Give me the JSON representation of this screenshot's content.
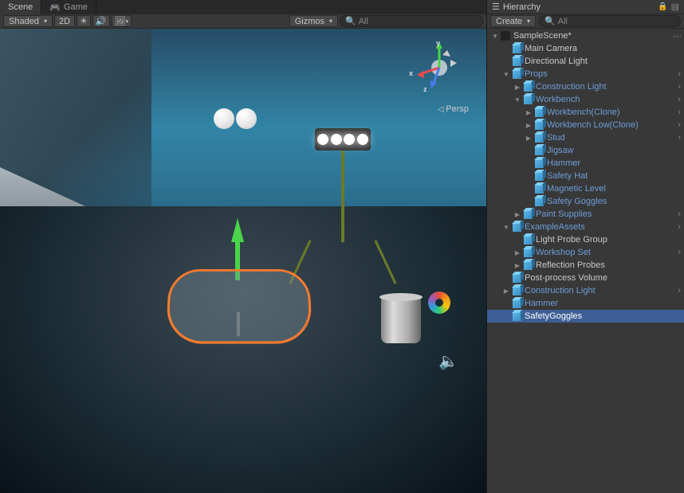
{
  "tabs": {
    "scene": "Scene",
    "game": "Game"
  },
  "scene_toolbar": {
    "shading": "Shaded",
    "mode_2d": "2D",
    "gizmos": "Gizmos",
    "search_placeholder": "All"
  },
  "gizmo": {
    "x": "x",
    "y": "y",
    "z": "z",
    "persp": "Persp"
  },
  "hierarchy": {
    "title": "Hierarchy",
    "create": "Create",
    "search_placeholder": "All",
    "tree": [
      {
        "label": "SampleScene*",
        "depth": 0,
        "expanded": true,
        "icon": "unity",
        "prefab": false,
        "chev": false,
        "menu": true
      },
      {
        "label": "Main Camera",
        "depth": 1,
        "expanded": null,
        "icon": "cube",
        "prefab": false,
        "chev": false
      },
      {
        "label": "Directional Light",
        "depth": 1,
        "expanded": null,
        "icon": "cube",
        "prefab": false,
        "chev": false
      },
      {
        "label": "Props",
        "depth": 1,
        "expanded": true,
        "icon": "cube",
        "prefab": true,
        "chev": true
      },
      {
        "label": "Construction Light",
        "depth": 2,
        "expanded": false,
        "icon": "cube",
        "prefab": true,
        "chev": true
      },
      {
        "label": "Workbench",
        "depth": 2,
        "expanded": true,
        "icon": "cube",
        "prefab": true,
        "chev": true
      },
      {
        "label": "Workbench(Clone)",
        "depth": 3,
        "expanded": false,
        "icon": "cube",
        "prefab": true,
        "chev": true
      },
      {
        "label": "Workbench Low(Clone)",
        "depth": 3,
        "expanded": false,
        "icon": "cube",
        "prefab": true,
        "chev": true
      },
      {
        "label": "Stud",
        "depth": 3,
        "expanded": false,
        "icon": "cube",
        "prefab": true,
        "chev": true
      },
      {
        "label": "Jigsaw",
        "depth": 3,
        "expanded": null,
        "icon": "cube",
        "prefab": true,
        "chev": false
      },
      {
        "label": "Hammer",
        "depth": 3,
        "expanded": null,
        "icon": "cube",
        "prefab": true,
        "chev": false
      },
      {
        "label": "Safety Hat",
        "depth": 3,
        "expanded": null,
        "icon": "cube",
        "prefab": true,
        "chev": false
      },
      {
        "label": "Magnetic Level",
        "depth": 3,
        "expanded": null,
        "icon": "cube",
        "prefab": true,
        "chev": false
      },
      {
        "label": "Safety Goggles",
        "depth": 3,
        "expanded": null,
        "icon": "cube",
        "prefab": true,
        "chev": false
      },
      {
        "label": "Paint Supplies",
        "depth": 2,
        "expanded": false,
        "icon": "cube",
        "prefab": true,
        "chev": true
      },
      {
        "label": "ExampleAssets",
        "depth": 1,
        "expanded": true,
        "icon": "cube",
        "prefab": true,
        "chev": true
      },
      {
        "label": "Light Probe Group",
        "depth": 2,
        "expanded": null,
        "icon": "cube",
        "prefab": false,
        "chev": false
      },
      {
        "label": "Workshop Set",
        "depth": 2,
        "expanded": false,
        "icon": "cube",
        "prefab": true,
        "chev": true
      },
      {
        "label": "Reflection Probes",
        "depth": 2,
        "expanded": false,
        "icon": "cube",
        "prefab": false,
        "chev": false
      },
      {
        "label": "Post-process Volume",
        "depth": 1,
        "expanded": null,
        "icon": "cube",
        "prefab": false,
        "chev": false
      },
      {
        "label": "Construction Light",
        "depth": 1,
        "expanded": false,
        "icon": "cube",
        "prefab": true,
        "chev": true
      },
      {
        "label": "Hammer",
        "depth": 1,
        "expanded": null,
        "icon": "cube",
        "prefab": true,
        "chev": false
      },
      {
        "label": "SafetyGoggles",
        "depth": 1,
        "expanded": null,
        "icon": "cube",
        "prefab": false,
        "chev": false,
        "selected": true
      }
    ]
  }
}
